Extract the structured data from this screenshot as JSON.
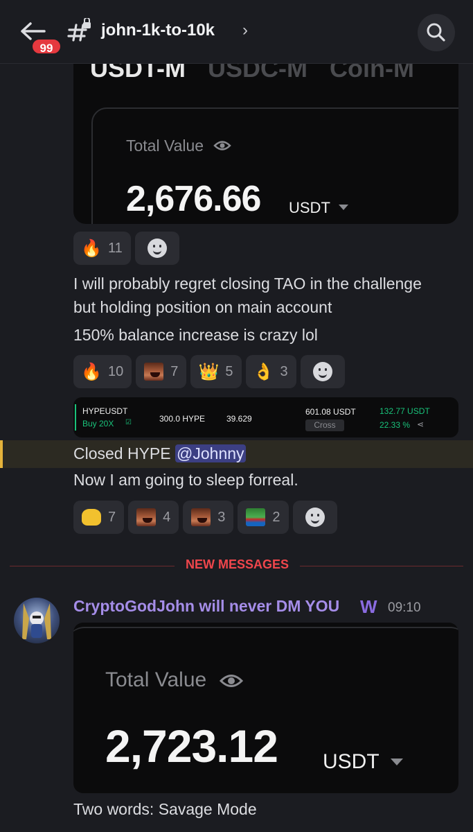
{
  "header": {
    "unread_badge": "99",
    "channel_name": "john-1k-to-10k",
    "chevron": "›"
  },
  "card1": {
    "tabs": [
      "USDT-M",
      "USDC-M",
      "Coin-M"
    ],
    "total_label": "Total Value",
    "total_value": "2,676.66",
    "unit": "USDT"
  },
  "reactions1": [
    {
      "emoji": "🔥",
      "count": "11"
    }
  ],
  "message1": {
    "line1": "I will probably regret closing TAO in the challenge",
    "line2": "but holding position on main account",
    "line3": "150% balance increase is crazy lol"
  },
  "reactions2": [
    {
      "emoji": "🔥",
      "count": "10"
    },
    {
      "emoji": "face-meme",
      "count": "7"
    },
    {
      "emoji": "👑",
      "count": "5"
    },
    {
      "emoji": "👌",
      "count": "3"
    }
  ],
  "trade": {
    "symbol": "HYPEUSDT",
    "side": "Buy 20X",
    "size": "300.0 HYPE",
    "entry": "39.629",
    "margin": "601.08 USDT",
    "mode": "Cross",
    "pnl": "132.77 USDT",
    "pnl_pct": "22.33 %"
  },
  "message2": {
    "text": "Closed HYPE ",
    "mention": "@Johnny",
    "line2": "Now I am going to sleep forreal."
  },
  "reactions3": [
    {
      "emoji": "hands",
      "count": "7"
    },
    {
      "emoji": "face-meme",
      "count": "4"
    },
    {
      "emoji": "face-meme",
      "count": "3"
    },
    {
      "emoji": "pepe",
      "count": "2"
    }
  ],
  "divider": {
    "label": "NEW MESSAGES"
  },
  "new_message": {
    "author": "CryptoGodJohn will never DM YOU",
    "role_icon": "W",
    "time": "09:10",
    "total_label": "Total Value",
    "total_value": "2,723.12",
    "unit": "USDT",
    "text": "Two words: Savage Mode"
  },
  "colors": {
    "background": "#1b1c21",
    "accent_red": "#f0464c",
    "mention_bg": "#3c3f83",
    "author_purple": "#a58de8",
    "profit_green": "#19c27a"
  }
}
